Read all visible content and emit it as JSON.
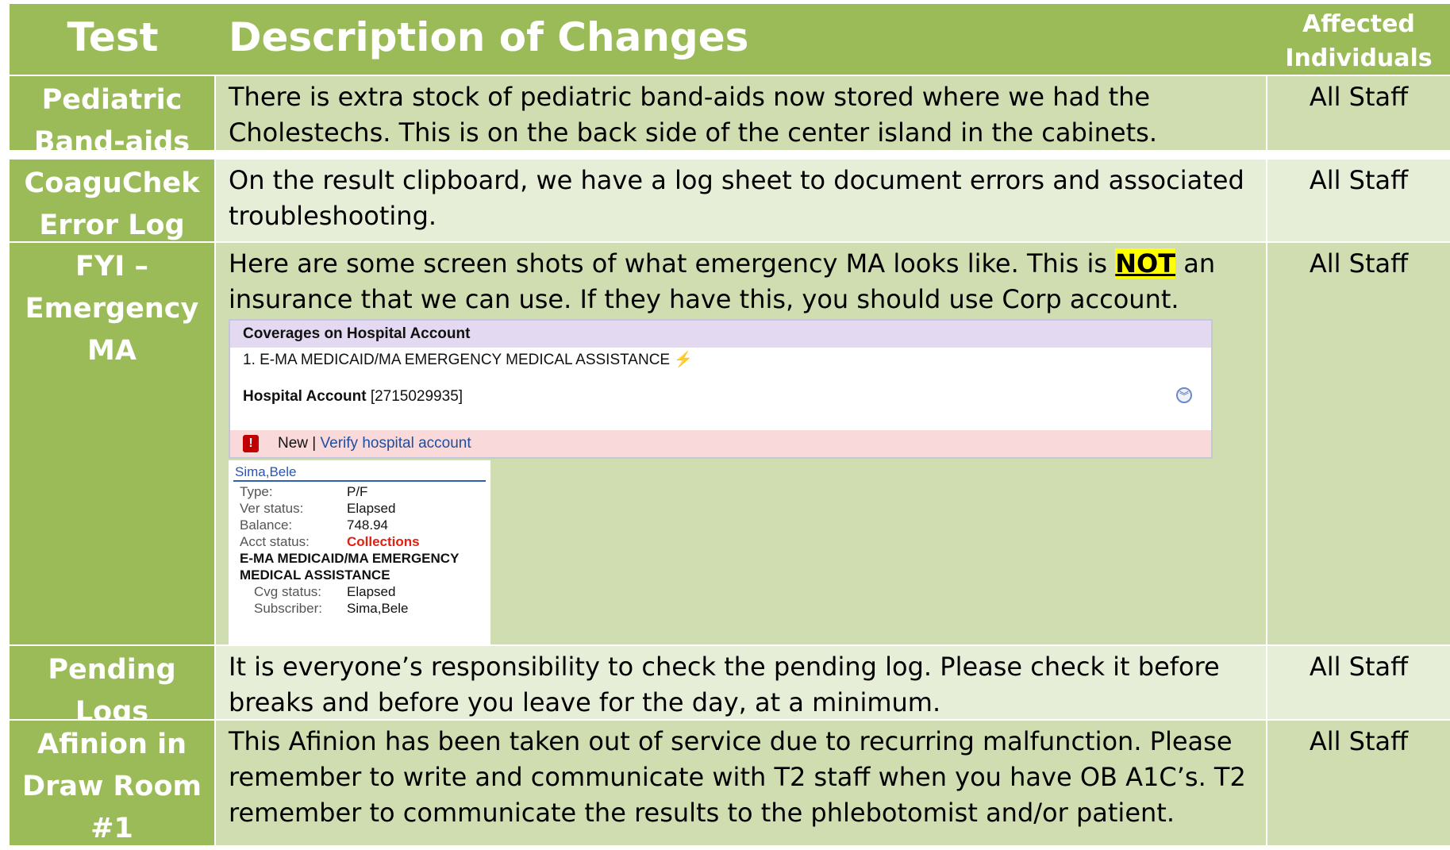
{
  "header": {
    "test": "Test",
    "description": "Description of Changes",
    "affected": "Affected Individuals"
  },
  "rows": [
    {
      "test": "Pediatric Band-aids",
      "description": "There is extra stock of pediatric band-aids now stored where we had the Cholestechs.  This is on the back side of the center island in the cabinets.",
      "affected": "All Staff"
    },
    {
      "test": "CoaguChek Error Log",
      "description": "On the result clipboard, we have a log sheet to document errors and associated troubleshooting.",
      "affected": "All Staff"
    },
    {
      "test": "FYI – Emergency MA",
      "description_pre": "Here are some screen shots of what emergency MA looks like.  This is ",
      "description_highlight": "NOT",
      "description_post": " an insurance that we can use.  If they have this, you should use Corp account.",
      "affected": "All Staff",
      "screenshot": {
        "header": "Coverages on Hospital Account",
        "coverage": "1. E-MA MEDICAID/MA EMERGENCY MEDICAL ASSISTANCE",
        "account_label": "Hospital Account",
        "account_number": "[2715029935]",
        "alert_new": "New",
        "alert_sep": " | ",
        "alert_link": "Verify hospital account"
      },
      "card": {
        "name": "Sima,Bele",
        "type_label": "Type:",
        "type_value": "P/F",
        "ver_label": "Ver status:",
        "ver_value": "Elapsed",
        "balance_label": "Balance:",
        "balance_value": "748.94",
        "acct_label": "Acct status:",
        "acct_value": "Collections",
        "coverage_line1": "E-MA MEDICAID/MA EMERGENCY",
        "coverage_line2": "MEDICAL ASSISTANCE",
        "cvg_label": "Cvg status:",
        "cvg_value": "Elapsed",
        "subscriber_label": "Subscriber:",
        "subscriber_value": "Sima,Bele"
      }
    },
    {
      "test": "Pending Logs",
      "description": "It is everyone’s responsibility to check the pending log.  Please check it before breaks and before you leave for the day, at a minimum.",
      "affected": "All Staff"
    },
    {
      "test": "Afinion in Draw Room #1",
      "description": "This Afinion has been taken out of service due to recurring malfunction.  Please remember to write and communicate with T2 staff when you have OB A1C’s.  T2 remember to communicate the results to the phlebotomist and/or patient.",
      "affected": "All Staff"
    }
  ]
}
